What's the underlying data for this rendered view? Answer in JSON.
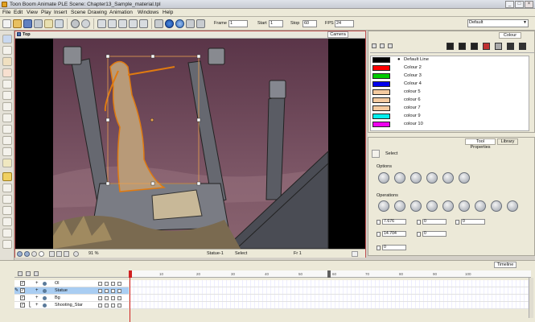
{
  "window": {
    "title": "Toon Boom Animate PLE Scene: Chapter13_Sample_material.tpl",
    "minimize": "_",
    "maximize": "□",
    "close": "×"
  },
  "menu": [
    "File",
    "Edit",
    "View",
    "Play",
    "Insert",
    "Scene",
    "Drawing",
    "Animation",
    "Windows",
    "Help"
  ],
  "toolbar": {
    "frame_label": "Frame",
    "frame_value": "1",
    "start_label": "Start",
    "start_value": "1",
    "stop_label": "Stop",
    "stop_value": "60",
    "fps_label": "FPS",
    "fps_value": "24",
    "workspace": "Default"
  },
  "viewport": {
    "view_name": "Top",
    "tab": "Camera",
    "zoom": "91 %",
    "layer": "Statue-1",
    "tool": "Select",
    "frame": "Fr 1"
  },
  "colour_panel": {
    "tab": "Colour",
    "colours": [
      {
        "name": "Default Line",
        "hex": "#000000"
      },
      {
        "name": "Colour 2",
        "hex": "#ff0000"
      },
      {
        "name": "Colour 3",
        "hex": "#00cc00"
      },
      {
        "name": "Colour 4",
        "hex": "#0000ee"
      },
      {
        "name": "colour 5",
        "hex": "#f4caa0"
      },
      {
        "name": "colour 6",
        "hex": "#f4caa0"
      },
      {
        "name": "colour 7",
        "hex": "#f4caa0"
      },
      {
        "name": "colour 9",
        "hex": "#00eeee"
      },
      {
        "name": "colour 10",
        "hex": "#ee00ee"
      }
    ]
  },
  "tool_properties": {
    "tab": "Tool Properties",
    "tab2": "Library",
    "tool_name": "Select",
    "options_label": "Options",
    "operations_label": "Operations",
    "x": "7.676",
    "y": "14.704",
    "w": "0",
    "h": "0",
    "angle": "0",
    "skew": "0",
    "rot": "0"
  },
  "timeline": {
    "tab": "Timeline",
    "ruler": [
      "10",
      "20",
      "30",
      "40",
      "50",
      "60",
      "70",
      "80",
      "90",
      "100"
    ],
    "layers": [
      {
        "name": "Ol",
        "selected": false
      },
      {
        "name": "Statue",
        "selected": true
      },
      {
        "name": "Bg",
        "selected": false
      },
      {
        "name": "Shooting_Star",
        "selected": false
      }
    ]
  }
}
